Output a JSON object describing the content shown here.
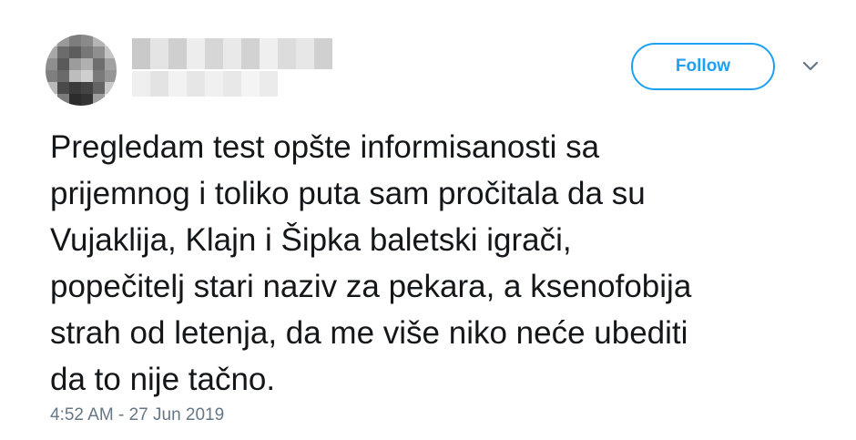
{
  "user": {
    "avatar_icon": "blurred-avatar-icon",
    "display_name": "",
    "handle": ""
  },
  "follow_button": {
    "label": "Follow",
    "color": "#1da1f2"
  },
  "menu": {
    "icon": "chevron-down-icon"
  },
  "tweet": {
    "text": "Pregledam test opšte informisanosti sa\nprijemnog i toliko puta sam pročitala da su\nVujaklija, Klajn i Šipka baletski igrači,\npopečitelj stari naziv za pekara, a ksenofobija\nstrah od letenja, da me više niko neće ubediti\nda to nije tačno.",
    "timestamp": "4:52 AM - 27 Jun 2019"
  },
  "colors": {
    "text": "#14171a",
    "muted": "#657786",
    "accent": "#1da1f2"
  }
}
